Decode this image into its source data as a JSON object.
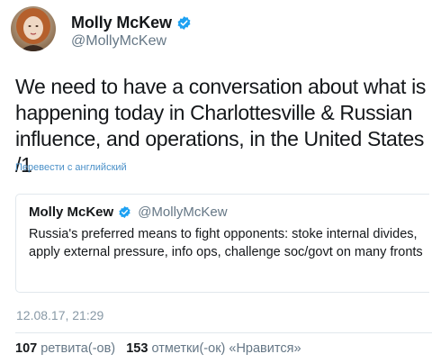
{
  "tweet": {
    "author": {
      "name": "Molly McKew",
      "handle": "@MollyMcKew",
      "verified": true
    },
    "text": "We need to have a conversation about what is happening today in Charlottesville & Russian influence, and operations, in the United States /1",
    "translate_label": "Перевести с английский",
    "timestamp": "12.08.17, 21:29",
    "stats": {
      "retweets_count": "107",
      "retweets_label": "ретвита(-ов)",
      "likes_count": "153",
      "likes_label": "отметки(-ок) «Нравится»"
    }
  },
  "quoted_tweet": {
    "author": {
      "name": "Molly McKew",
      "handle": "@MollyMcKew",
      "verified": true
    },
    "text": "Russia's preferred means to fight opponents: stoke internal divides, apply external pressure, info ops, challenge soc/govt on many fronts"
  },
  "colors": {
    "verified_badge": "#1da1f2",
    "link": "#4a90c8",
    "secondary_text": "#657786"
  },
  "icons": {
    "verified": "verified-badge-icon"
  }
}
